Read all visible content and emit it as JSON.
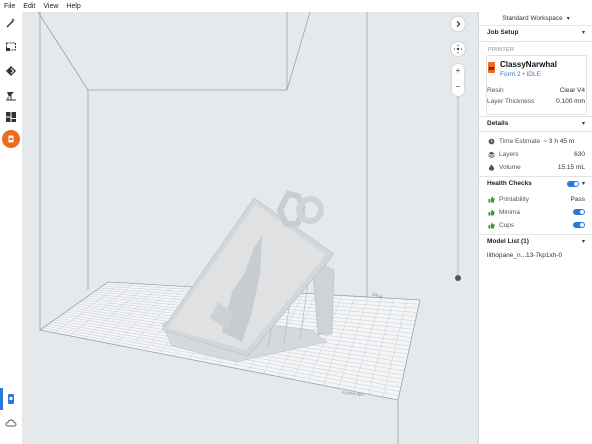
{
  "menubar": {
    "items": [
      "File",
      "Edit",
      "View",
      "Help"
    ]
  },
  "toolbar": {
    "tools": [
      "magic-wand-icon",
      "select-box-icon",
      "orient-icon",
      "supports-icon",
      "layout-icon",
      "print-icon"
    ],
    "bottom": [
      "printer-device-icon",
      "cloud-icon"
    ],
    "accent": "#ee6a1f",
    "select_color": "#2b7bd6"
  },
  "workspace": {
    "label": "Standard Workspace"
  },
  "job_setup": {
    "title": "Job Setup",
    "printer_caption": "PRINTER",
    "printer_name": "ClassyNarwhal",
    "printer_status": "Form 2 • IDLE",
    "resin_label": "Resin",
    "resin_value": "Clear V4",
    "layer_label": "Layer Thickness",
    "layer_value": "0.100 mm"
  },
  "details": {
    "title": "Details",
    "time_label": "Time Estimate",
    "time_value": "~ 3 h 45 m",
    "layers_label": "Layers",
    "layers_value": "630",
    "volume_label": "Volume",
    "volume_value": "15.15 mL"
  },
  "health": {
    "title": "Health Checks",
    "printability_label": "Printability",
    "printability_value": "Pass",
    "minima_label": "Minima",
    "cups_label": "Cups"
  },
  "model_list": {
    "title": "Model List (1)",
    "items": [
      "lithopane_n...13-7kp1xh-0"
    ]
  },
  "viewport": {
    "plate_label_back": "BACK",
    "plate_label_front": "FORMLABS"
  }
}
